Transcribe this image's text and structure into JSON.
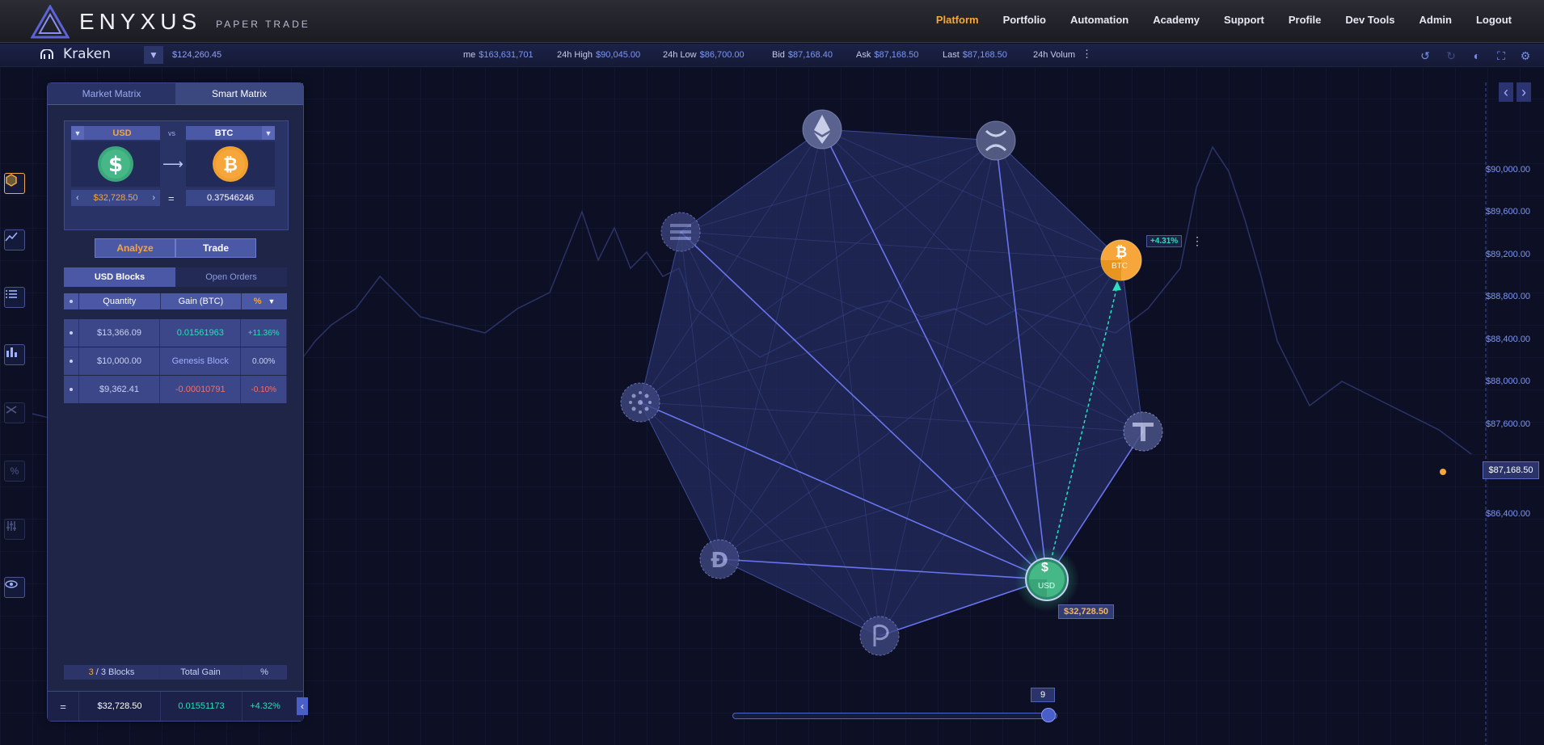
{
  "brand": {
    "name": "ENYXUS",
    "subtitle": "PAPER TRADE"
  },
  "nav": [
    "Platform",
    "Portfolio",
    "Automation",
    "Academy",
    "Support",
    "Profile",
    "Dev Tools",
    "Admin",
    "Logout"
  ],
  "nav_active": "Platform",
  "ticker": {
    "exchange": "Kraken",
    "balance": "$124,260.45",
    "items": [
      {
        "k": "me",
        "v": "$163,631,701"
      },
      {
        "k": "24h High",
        "v": "$90,045.00"
      },
      {
        "k": "24h Low",
        "v": "$86,700.00"
      },
      {
        "k": "Bid",
        "v": "$87,168.40"
      },
      {
        "k": "Ask",
        "v": "$87,168.50"
      },
      {
        "k": "Last",
        "v": "$87,168.50"
      },
      {
        "k": "24h Volum",
        "v": ""
      }
    ]
  },
  "axis": {
    "labels": [
      "$90,000.00",
      "$89,600.00",
      "$89,200.00",
      "$88,800.00",
      "$88,400.00",
      "$88,000.00",
      "$87,600.00",
      "$86,400.00"
    ],
    "current_price": "$87,168.50"
  },
  "panel": {
    "tabs": [
      "Market Matrix",
      "Smart Matrix"
    ],
    "active_tab": "Smart Matrix",
    "from_currency": "USD",
    "to_currency": "BTC",
    "vs_label": "vs",
    "from_amount": "$32,728.50",
    "to_amount": "0.37546246",
    "equals": "=",
    "analyze_label": "Analyze",
    "trade_label": "Trade",
    "block_tabs": [
      "USD Blocks",
      "Open Orders"
    ],
    "columns": {
      "quantity": "Quantity",
      "gain": "Gain  (BTC)",
      "pct": "%"
    },
    "rows": [
      {
        "quantity": "$13,366.09",
        "gain": "0.01561963",
        "pct": "+11.36%",
        "tone": "pos"
      },
      {
        "quantity": "$10,000.00",
        "gain": "Genesis Block",
        "pct": "0.00%",
        "tone": "neutral"
      },
      {
        "quantity": "$9,362.41",
        "gain": "-0.00010791",
        "pct": "-0.10%",
        "tone": "neg"
      }
    ],
    "footer": {
      "blocks_used": "3",
      "blocks_sep": " / 3 Blocks",
      "total_gain": "Total Gain",
      "pct": "%"
    },
    "total": {
      "eq": "=",
      "amount": "$32,728.50",
      "gain": "0.01551173",
      "pct": "+4.32%"
    }
  },
  "graph": {
    "btc_label": "BTC",
    "btc_change": "+4.31%",
    "usd_label": "USD",
    "usd_value": "$32,728.50",
    "slider_value": "9"
  },
  "colors": {
    "accent": "#f6a63a",
    "positive": "#28e0b4",
    "negative": "#ff6b5f",
    "primary": "#4a58a6",
    "background": "#0d1024"
  },
  "icons": [
    "ethereum-icon",
    "xrp-icon",
    "solana-icon",
    "btc-icon",
    "cardano-icon",
    "tether-icon",
    "dogecoin-icon",
    "polkadot-icon",
    "usd-icon"
  ]
}
